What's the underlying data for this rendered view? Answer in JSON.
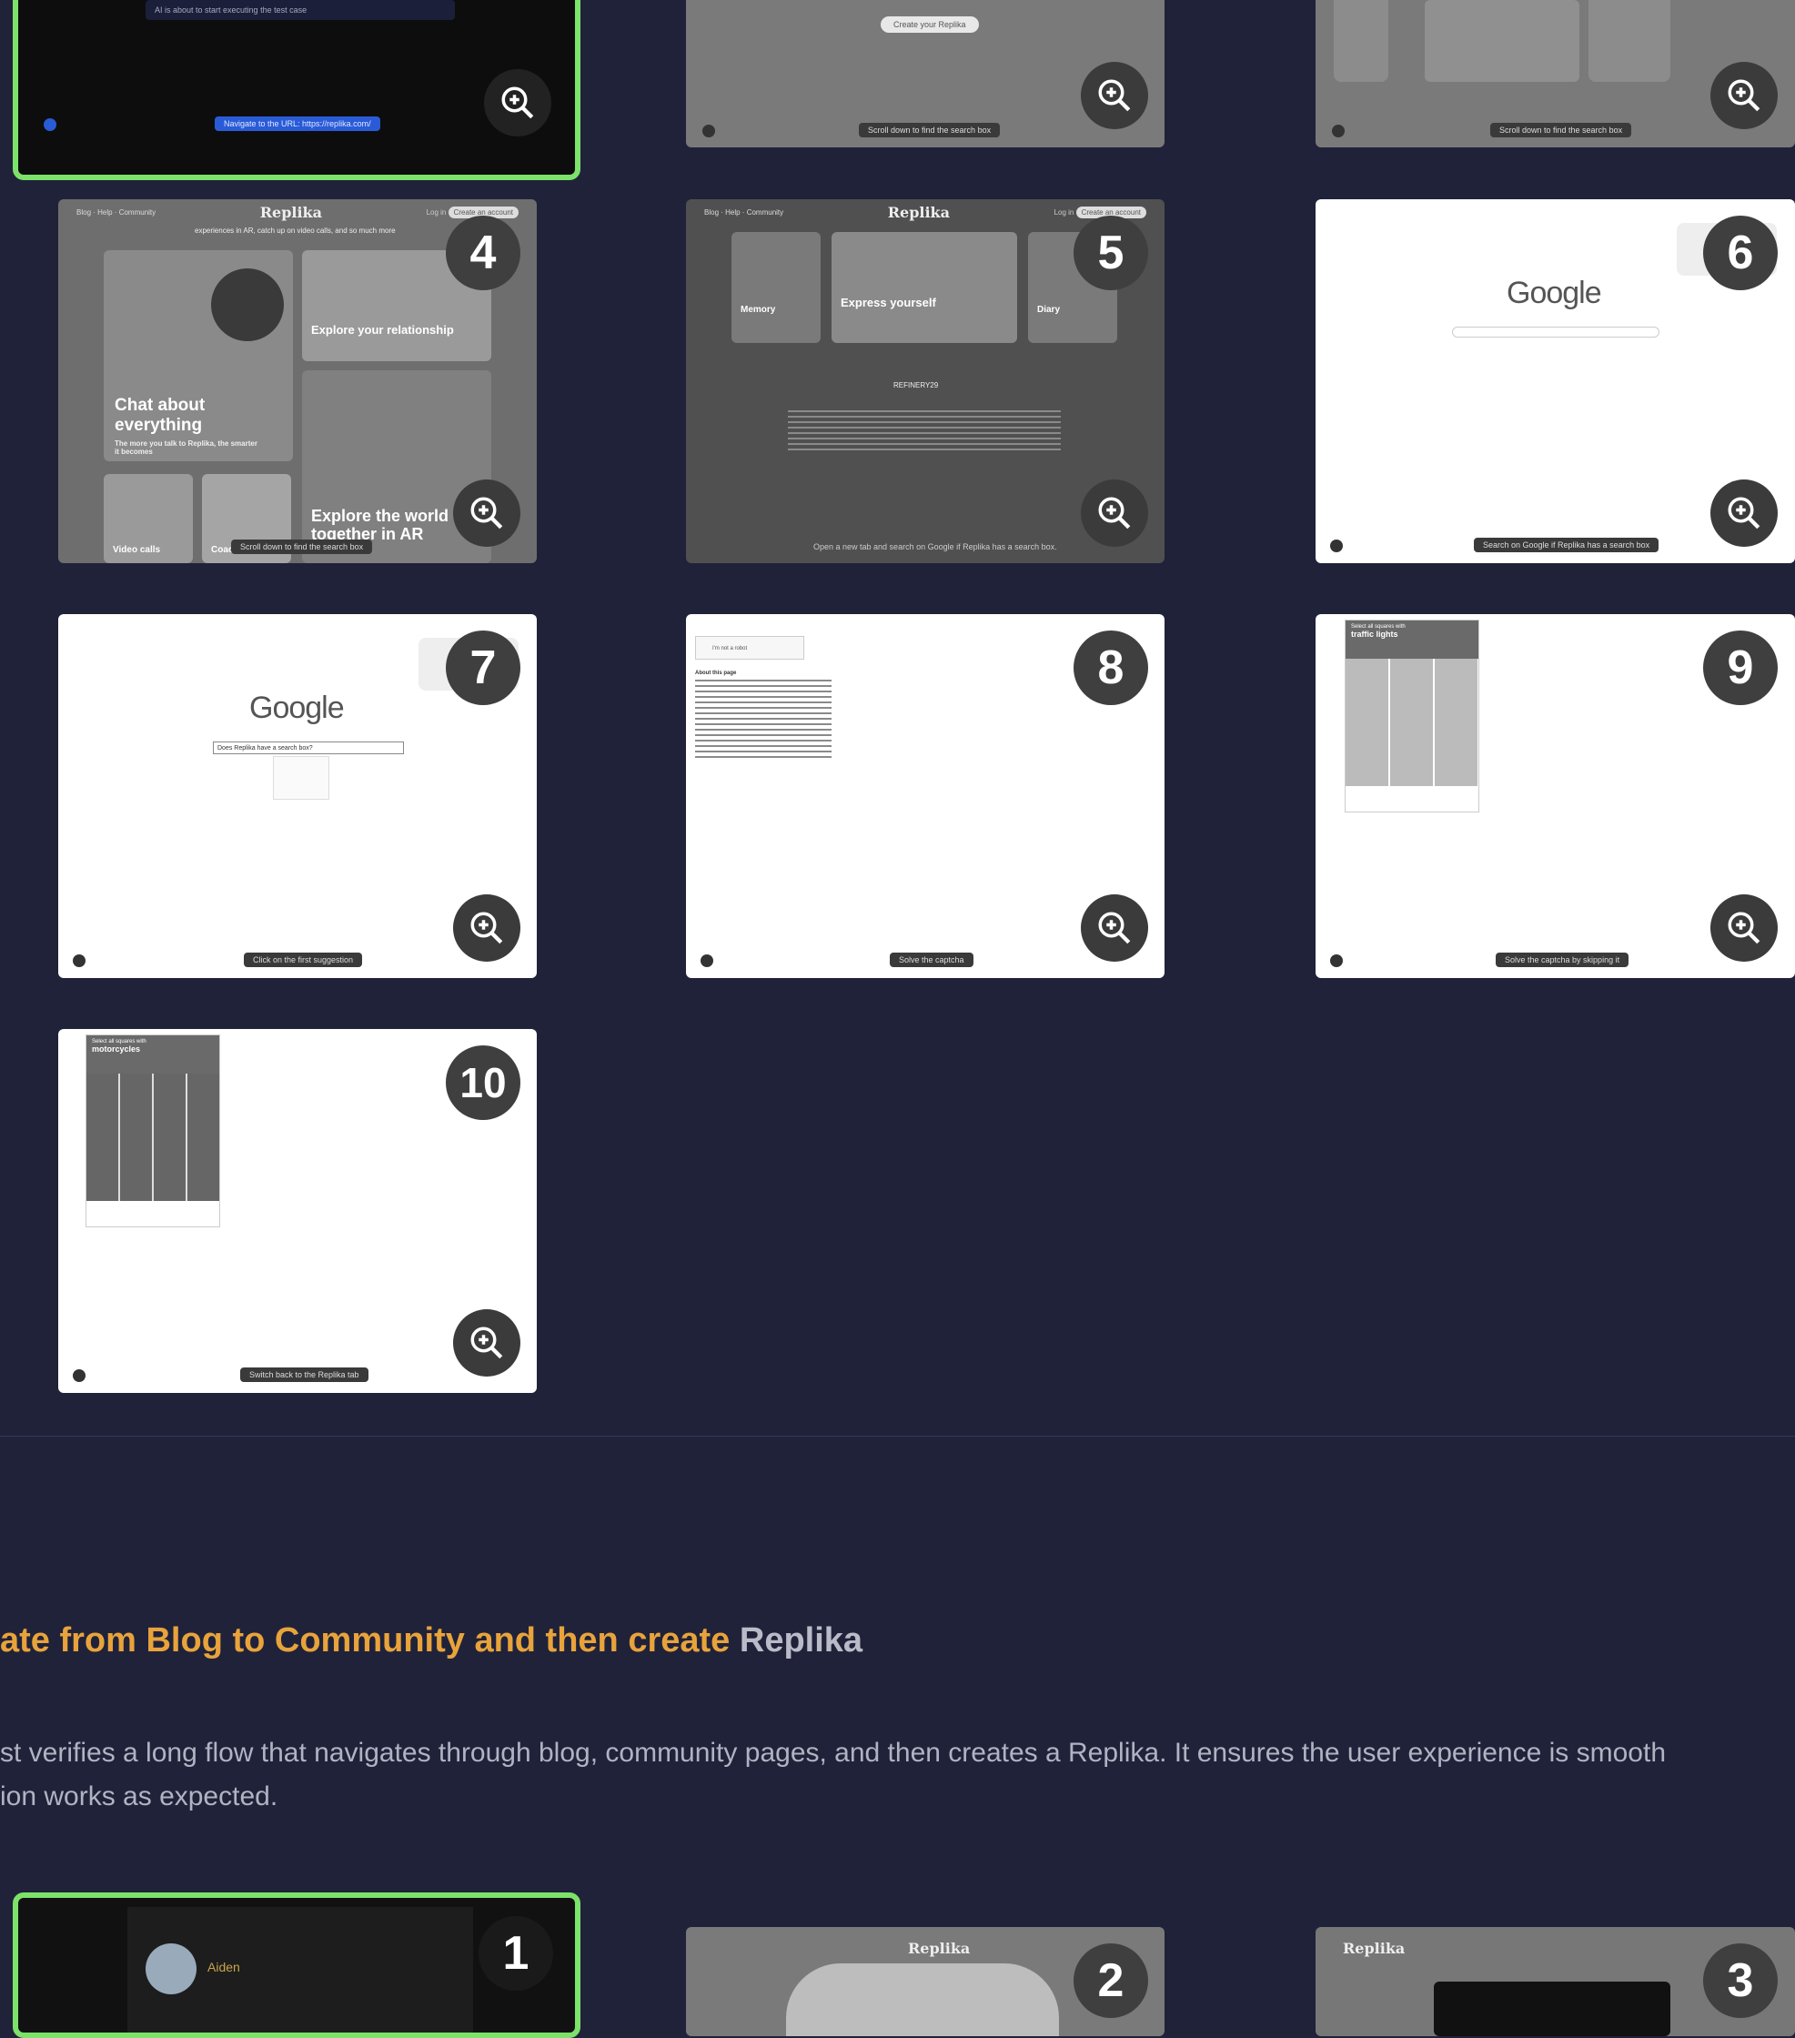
{
  "cards_top": [
    {
      "id": "card-prev-a",
      "caption": "Navigate to the URL: https://replika.com/",
      "status_text": "AI is about to start executing the test case"
    },
    {
      "id": "card-prev-b",
      "caption": "Scroll down to find the search box",
      "button_text": "Create your Replika"
    },
    {
      "id": "card-prev-c",
      "caption": "Scroll down to find the search box"
    }
  ],
  "steps": [
    {
      "number": "4",
      "caption": "Scroll down to find the search box",
      "brand": "Replika",
      "nav": [
        "Blog",
        "Help",
        "Community"
      ],
      "nav_right": [
        "Log in",
        "Create an account"
      ],
      "headline": "experiences in AR, catch up on video calls, and so much more",
      "tiles": [
        "Chat about everything",
        "Explore your relationship",
        "Explore the world together in AR",
        "Video calls",
        "Coaching"
      ],
      "tile_sub": "The more you talk to Replika, the smarter it becomes"
    },
    {
      "number": "5",
      "caption": "Open a new tab and search on Google if Replika has a search box.",
      "brand": "Replika",
      "nav": [
        "Blog",
        "Help",
        "Community"
      ],
      "nav_right": [
        "Log in",
        "Create an account"
      ],
      "tiles": [
        "Memory",
        "Express yourself",
        "Diary"
      ],
      "press": "REFINERY29"
    },
    {
      "number": "6",
      "caption": "Search on Google if Replika has a search box",
      "logo": "Google"
    },
    {
      "number": "7",
      "caption": "Click on the first suggestion",
      "logo": "Google",
      "search_value": "Does Replika have a search box?"
    },
    {
      "number": "8",
      "caption": "Solve the captcha",
      "checkbox_label": "I'm not a robot",
      "about": "About this page"
    },
    {
      "number": "9",
      "caption": "Solve the captcha by skipping it",
      "captcha_target": "traffic lights",
      "captcha_prompt": "Select all squares with"
    },
    {
      "number": "10",
      "caption": "Switch back to the Replika tab",
      "captcha_target": "motorcycles",
      "captcha_prompt": "Select all squares with"
    }
  ],
  "section": {
    "title_highlight": "ate from Blog to Community and then create ",
    "title_plain": "Replika",
    "desc_line1": "st verifies a long flow that navigates through blog, community pages, and then creates a Replika. It ensures the user experience is smooth",
    "desc_line2": "ion works as expected."
  },
  "next_cards": [
    {
      "number": "1",
      "user": "Aiden"
    },
    {
      "number": "2",
      "brand": "Replika"
    },
    {
      "number": "3",
      "brand": "Replika"
    }
  ],
  "colors": {
    "background": "#20223a",
    "accent": "#e8a33b",
    "active_border": "#7ce26a"
  }
}
